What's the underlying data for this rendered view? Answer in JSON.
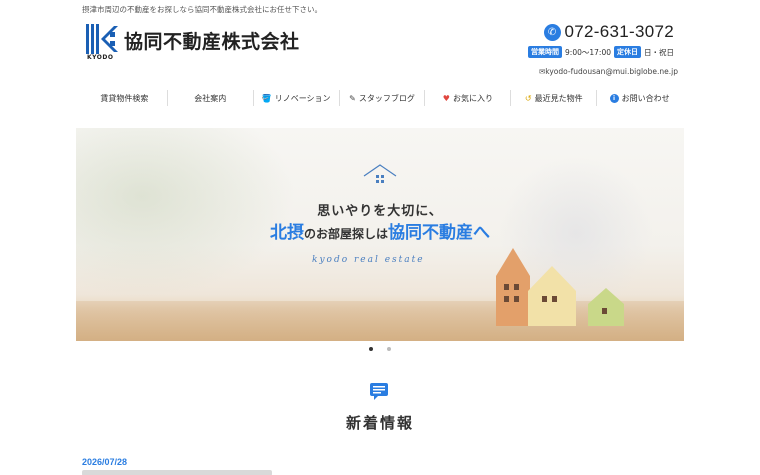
{
  "header": {
    "tagline": "摂津市周辺の不動産をお探しなら協同不動産株式会社にお任せ下さい。",
    "logo_sub": "KYODO",
    "company_name": "協同不動産株式会社",
    "phone": "072-631-3072",
    "hours_label": "営業時間",
    "hours": "9:00～17:00",
    "closed_label": "定休日",
    "closed_days": "日・祝日",
    "email": "✉kyodo-fudousan@mui.biglobe.ne.jp"
  },
  "nav": {
    "items": [
      {
        "label": "賃貸物件検索",
        "icon": ""
      },
      {
        "label": "会社案内",
        "icon": ""
      },
      {
        "label": "リノベーション",
        "icon": "paint-bucket-icon"
      },
      {
        "label": "スタッフブログ",
        "icon": "document-edit-icon"
      },
      {
        "label": "お気に入り",
        "icon": "heart-icon"
      },
      {
        "label": "最近見た物件",
        "icon": "history-icon"
      },
      {
        "label": "お問い合わせ",
        "icon": "info-icon"
      }
    ]
  },
  "hero": {
    "line1": "思いやりを大切に、",
    "line2_a": "北摂",
    "line2_b": "のお部屋探しは",
    "line2_c": "協同不動産へ",
    "script": "kyodo real estate"
  },
  "slider": {
    "current": 1,
    "total": 2
  },
  "news": {
    "title": "新着情報",
    "first_date": "2026/07/28"
  },
  "colors": {
    "accent": "#2a7de1",
    "heart": "#e0473f"
  }
}
